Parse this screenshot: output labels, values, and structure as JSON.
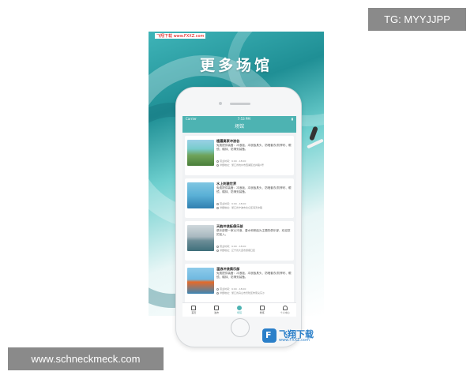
{
  "promo": {
    "title": "更多场馆",
    "source_tag": "飞翔下载 www.FXXZ.com"
  },
  "phone": {
    "status": {
      "carrier": "Carrier",
      "time": "7:53 PM"
    },
    "nav_title": "场馆",
    "venues": [
      {
        "name": "植霞高家冲浪谷",
        "desc": "免费提供装备：冲浪板、冲浪板具头、防晒套衣/防摩布、眼镜、帽袜、防滑安装备。",
        "hours": "营业时间：9:00 - 18:00",
        "address": "详细地址：浙江省杭州市西湖区龙井路1号"
      },
      {
        "name": "水上刺激世界",
        "desc": "免费提供装备：冲浪板、冲浪板具头、防晒套衣/防摩布、眼镜、帽袜、防滑安装备。",
        "hours": "营业时间：9:00 - 18:00",
        "address": "详细地址：浙江省宁波市北仑区海天中路"
      },
      {
        "name": "天韵冲浪板俱乐部",
        "desc": "俱乐部是一家以冲浪、潜水和帆船为主题的俱乐部，欢迎您的加入。",
        "hours": "营业时间：9:00 - 18:00",
        "address": "详细地址：辽宁省大连市旅顺口区"
      },
      {
        "name": "温浪冲浪俱乐部",
        "desc": "免费提供装备：冲浪板、冲浪板具头、防晒套衣/防摩布、眼镜、帽袜、防滑安装备。",
        "hours": "营业时间：9:00 - 18:00",
        "address": "详细地址：浙江省舟山市普陀区朱家尖东沙"
      }
    ],
    "tabs": [
      {
        "label": "首页",
        "icon": "home-icon"
      },
      {
        "label": "发布",
        "icon": "edit-icon"
      },
      {
        "label": "场馆",
        "icon": "venue-icon",
        "active": true
      },
      {
        "label": "教练",
        "icon": "coach-icon"
      },
      {
        "label": "个人中心",
        "icon": "user-icon"
      }
    ]
  },
  "watermarks": {
    "tg": "TG: MYYJJPP",
    "site": "www.schneckmeck.com",
    "logo_text": "飞翔下载",
    "logo_url": "www.FXXZ.com"
  },
  "colors": {
    "accent": "#4db3b2",
    "watermark_bg": "#8a8a8a"
  }
}
